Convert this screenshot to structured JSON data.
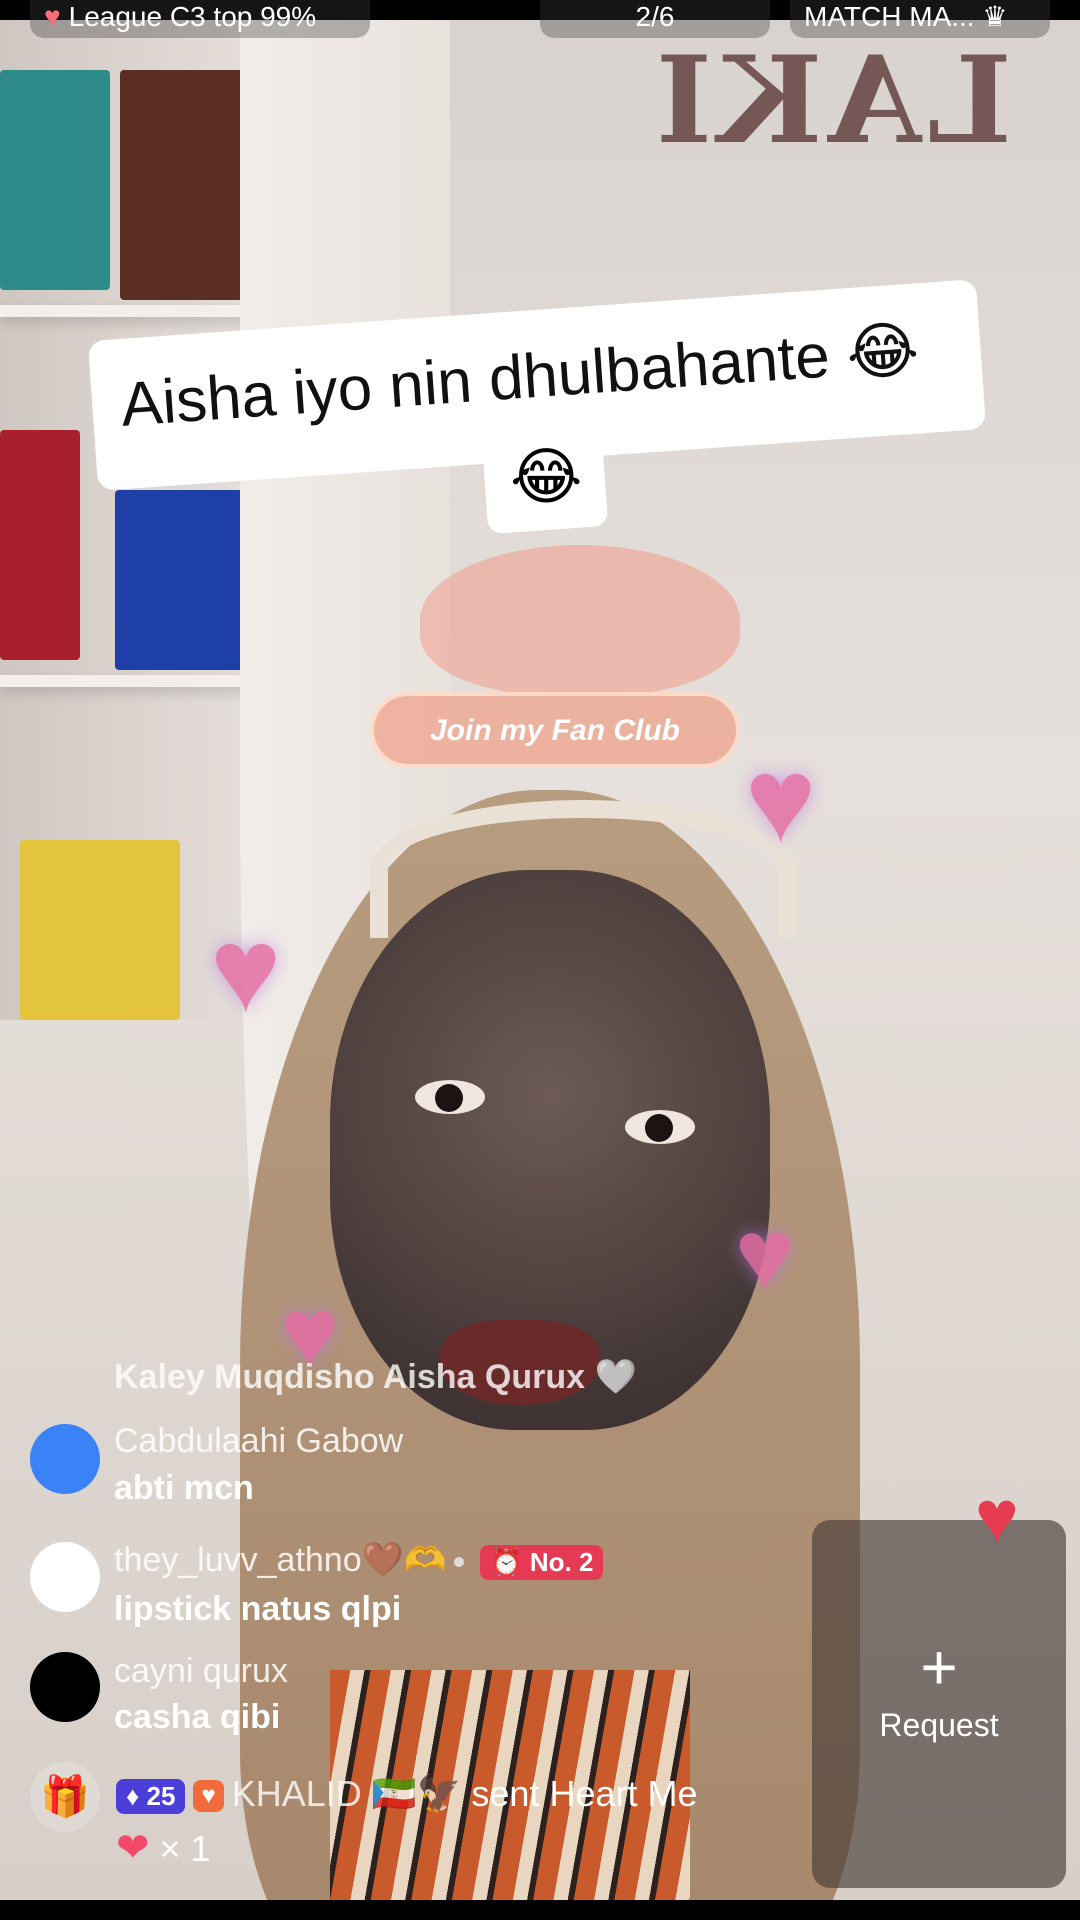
{
  "top_bar": {
    "league": "League C3 top 99%",
    "rank": "2/6",
    "match": "MATCH MA..."
  },
  "background_sign": "LAKI",
  "caption": {
    "text": "Aisha iyo nin dhulbahante 😂",
    "emoji_line": "😂"
  },
  "fan_club": {
    "button_label": "Join my Fan Club"
  },
  "comments": {
    "plain": "Kaley Muqdisho Aisha Qurux 🤍",
    "items": [
      {
        "name": "Cabdulaahi Gabow",
        "message": "abti mcn",
        "avatar_color": "#3b82f6"
      },
      {
        "name": "they_luvv_athno🤎🫶",
        "badge": "No. 2",
        "message": "lipstick natus qlpi",
        "avatar_color": "#ffffff"
      },
      {
        "name": "cayni qurux",
        "message": "casha qibi",
        "avatar_color": "#000000"
      }
    ]
  },
  "gift": {
    "level": "25",
    "user": "KHALID 🇬🇶🦅",
    "action": "sent Heart Me",
    "count": "× 1"
  },
  "request": {
    "plus": "+",
    "label": "Request"
  },
  "like_icon": "heart-icon",
  "colors": {
    "like": "#e43c4e",
    "no2_badge": "#e63a54",
    "level_badge": "#4a3fd9"
  }
}
